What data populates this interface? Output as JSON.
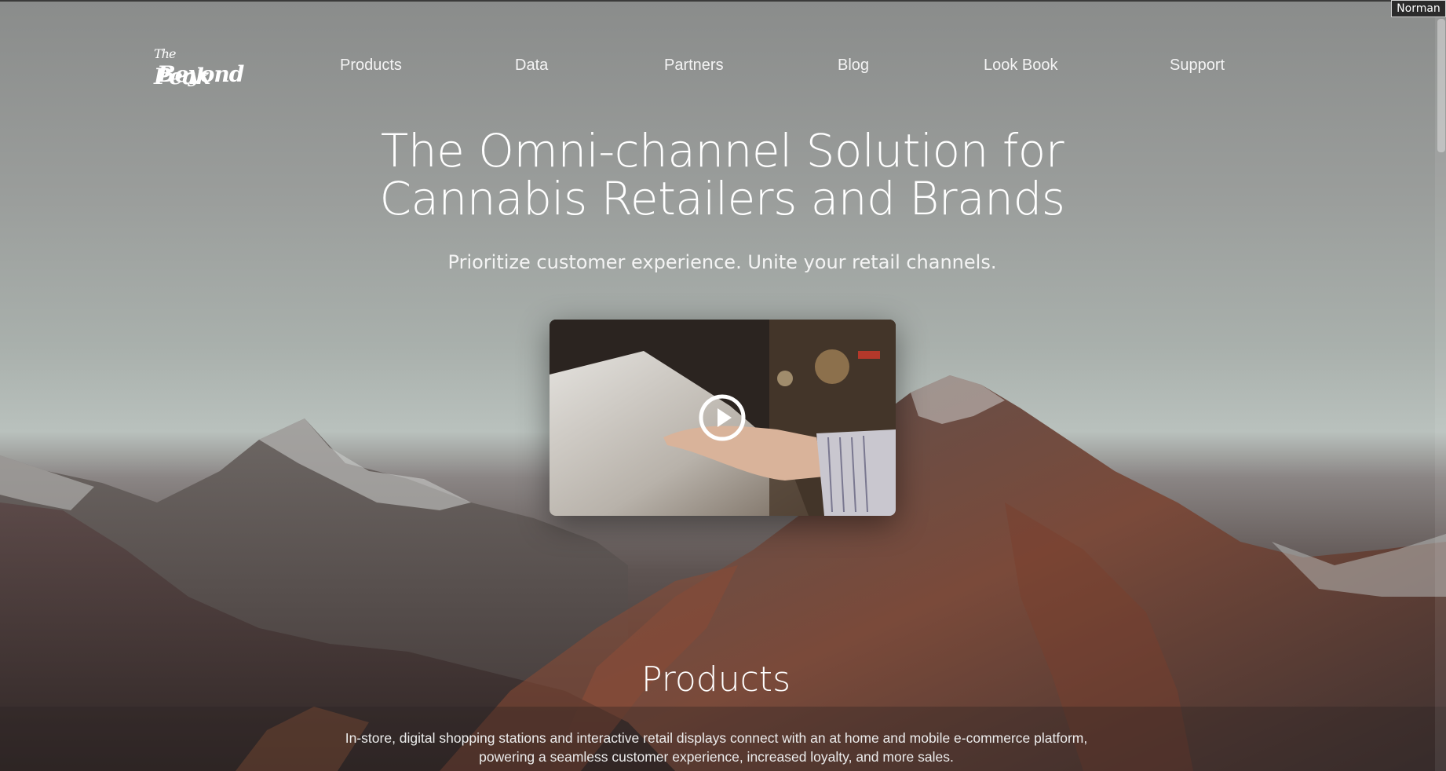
{
  "user_tag": "Norman",
  "logo": {
    "line1_small": "The",
    "line1": "Peak",
    "line2": "Beyond"
  },
  "nav": [
    {
      "label": "Products"
    },
    {
      "label": "Data"
    },
    {
      "label": "Partners"
    },
    {
      "label": "Blog"
    },
    {
      "label": "Look Book"
    },
    {
      "label": "Support"
    }
  ],
  "hero": {
    "title_line1": "The Omni-channel Solution for",
    "title_line2": "Cannabis Retailers and Brands",
    "subtitle": "Prioritize customer experience. Unite your retail channels."
  },
  "video": {
    "icon": "play-icon"
  },
  "products_section": {
    "title": "Products",
    "description_line1": "In-store, digital shopping stations and interactive retail displays connect with an at home and mobile e-commerce platform,",
    "description_line2": "powering a seamless customer experience, increased loyalty, and more sales."
  },
  "colors": {
    "text": "#ffffff",
    "sky": "#a9b0ac",
    "mountain_dark": "#4a3f3d",
    "mountain_rust": "#8a4a34"
  }
}
